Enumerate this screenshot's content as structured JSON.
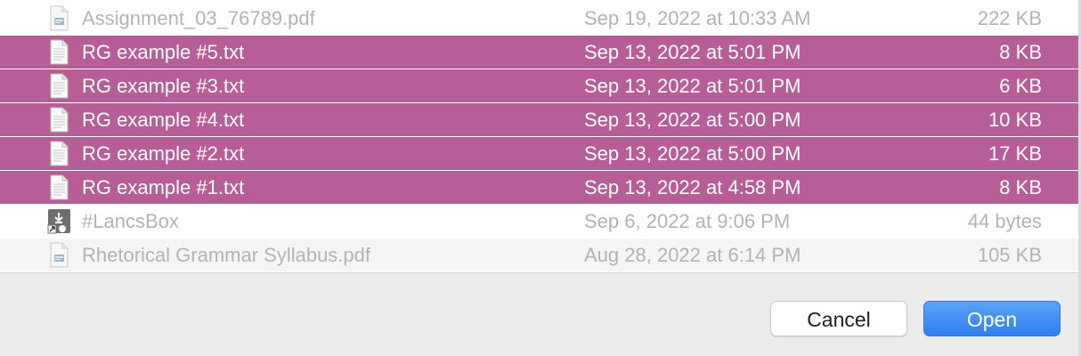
{
  "files": [
    {
      "name": "Assignment_03_76789.pdf",
      "date": "Sep 19, 2022 at 10:33 AM",
      "size": "222 KB",
      "type": "pdf",
      "selected": false
    },
    {
      "name": "RG example #5.txt",
      "date": "Sep 13, 2022 at 5:01 PM",
      "size": "8 KB",
      "type": "txt",
      "selected": true
    },
    {
      "name": "RG example #3.txt",
      "date": "Sep 13, 2022 at 5:01 PM",
      "size": "6 KB",
      "type": "txt",
      "selected": true
    },
    {
      "name": "RG example #4.txt",
      "date": "Sep 13, 2022 at 5:00 PM",
      "size": "10 KB",
      "type": "txt",
      "selected": true
    },
    {
      "name": "RG example #2.txt",
      "date": "Sep 13, 2022 at 5:00 PM",
      "size": "17 KB",
      "type": "txt",
      "selected": true
    },
    {
      "name": "RG example #1.txt",
      "date": "Sep 13, 2022 at 4:58 PM",
      "size": "8 KB",
      "type": "txt",
      "selected": true
    },
    {
      "name": "#LancsBox",
      "date": "Sep 6, 2022 at 9:06 PM",
      "size": "44 bytes",
      "type": "alias",
      "selected": false
    },
    {
      "name": "Rhetorical Grammar Syllabus.pdf",
      "date": "Aug 28, 2022 at 6:14 PM",
      "size": "105 KB",
      "type": "pdf",
      "selected": false
    }
  ],
  "buttons": {
    "cancel_label": "Cancel",
    "open_label": "Open"
  },
  "colors": {
    "selection": "#b75e98",
    "dimmed_text": "#b3b3b3",
    "primary_button": "#2f7ff0"
  }
}
